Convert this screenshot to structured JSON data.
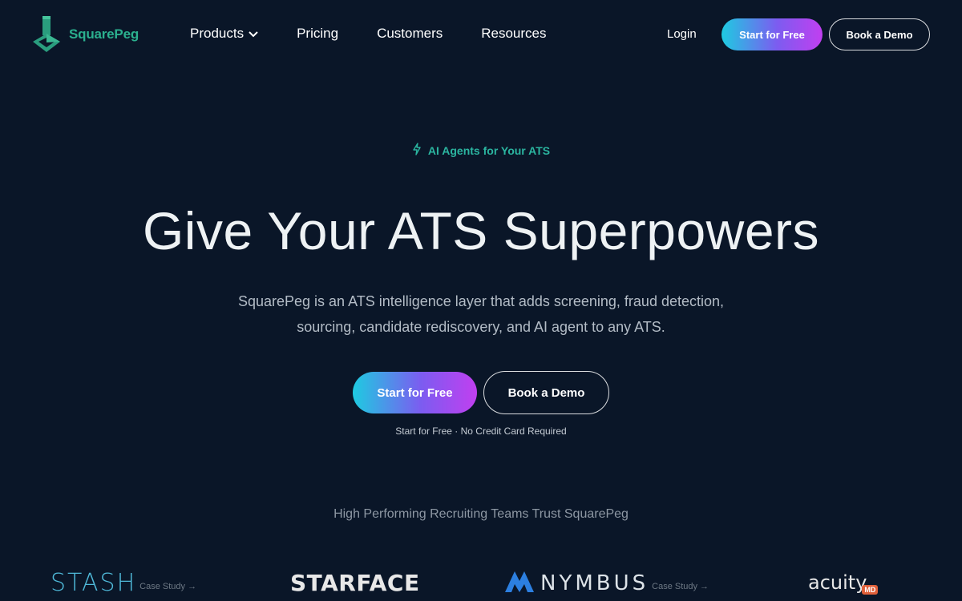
{
  "nav": {
    "brand": "SquarePeg",
    "links": [
      "Products",
      "Pricing",
      "Customers",
      "Resources"
    ],
    "login": "Login",
    "start_free": "Start for Free",
    "book_demo": "Book a Demo"
  },
  "hero": {
    "eyebrow": "AI Agents for Your ATS",
    "headline": "Give Your ATS Superpowers",
    "subtext": "SquarePeg is an ATS intelligence layer that adds screening, fraud detection, sourcing, candidate rediscovery, and AI agent to any ATS.",
    "start_free": "Start for Free",
    "book_demo": "Book a Demo",
    "note": "Start for Free · No Credit Card Required"
  },
  "trust": {
    "heading": "High Performing Recruiting Teams Trust SquarePeg",
    "brands": [
      {
        "name": "STASH",
        "case_study": "Case Study →"
      },
      {
        "name": "STARFACE",
        "case_study": ""
      },
      {
        "name": "NYMBUS",
        "case_study": "Case Study →"
      },
      {
        "name": "acuity",
        "tag": "MD",
        "case_study": ""
      }
    ]
  },
  "colors": {
    "background": "#0a1628",
    "accent_teal": "#2bb08e",
    "gradient_start": "#1ecbe1",
    "gradient_end": "#c13ff0"
  },
  "icons": {
    "logo": "squarepeg-logo-icon",
    "products_dropdown": "chevron-down-icon",
    "eyebrow": "lightning-bolt-icon",
    "nymbus": "nymbus-mark-icon"
  }
}
